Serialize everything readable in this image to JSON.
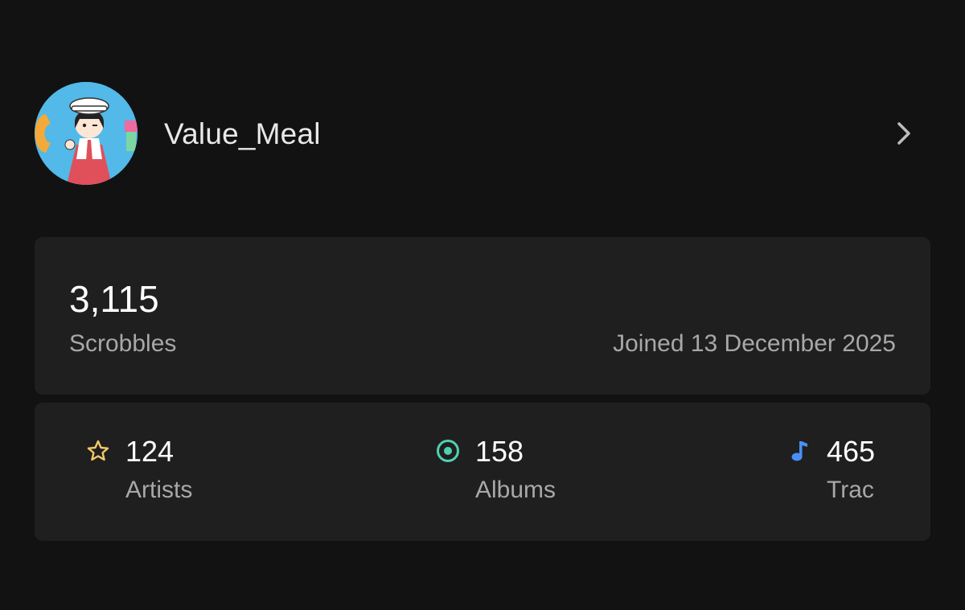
{
  "profile": {
    "username": "Value_Meal",
    "avatar_icon": "avatar-image",
    "chevron_icon": "chevron-right-icon"
  },
  "scrobbles": {
    "count": "3,115",
    "label": "Scrobbles",
    "joined": "Joined 13 December 2025"
  },
  "stats": {
    "artists": {
      "value": "124",
      "label": "Artists",
      "icon": "star-icon",
      "color": "#f3c969"
    },
    "albums": {
      "value": "158",
      "label": "Albums",
      "icon": "album-icon",
      "color": "#4fd1b0"
    },
    "tracks": {
      "value": "465",
      "label": "Trac",
      "icon": "music-note-icon",
      "color": "#4a8ff7"
    }
  },
  "colors": {
    "background": "#121212",
    "card": "#1f1f1f"
  }
}
